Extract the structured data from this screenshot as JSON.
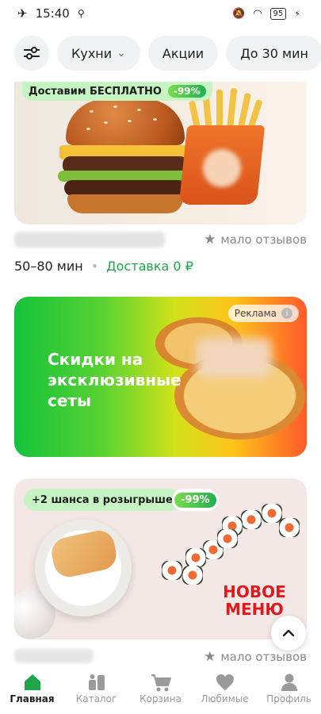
{
  "status_bar": {
    "time": "15:40",
    "battery": "95"
  },
  "filters": {
    "cuisines_label": "Кухни",
    "promotions_label": "Акции",
    "time_label": "До 30 мин"
  },
  "card1": {
    "badge_text": "Доставим БЕСПЛАТНО",
    "badge_discount": "-99%",
    "rating_text": "мало отзывов",
    "delivery_time": "50–80 мин",
    "delivery_price": "Доставка 0 ₽"
  },
  "ad": {
    "title": "Скидки на эксклюзивные сеты",
    "label": "Реклама"
  },
  "card2": {
    "badge_text": "+2 шанса в розыгрыше",
    "badge_discount": "-99%",
    "promo_text": "НОВОЕ МЕНЮ",
    "rating_text": "мало отзывов"
  },
  "bottom_nav": {
    "items": [
      {
        "label": "Главная",
        "icon": "home-icon"
      },
      {
        "label": "Каталог",
        "icon": "catalog-icon"
      },
      {
        "label": "Корзина",
        "icon": "cart-icon"
      },
      {
        "label": "Любимые",
        "icon": "heart-icon"
      },
      {
        "label": "Профиль",
        "icon": "profile-icon"
      }
    ]
  },
  "colors": {
    "accent_green": "#1fa64a",
    "nav_active": "#1e1e1e",
    "nav_inactive": "#9a9a9a"
  }
}
